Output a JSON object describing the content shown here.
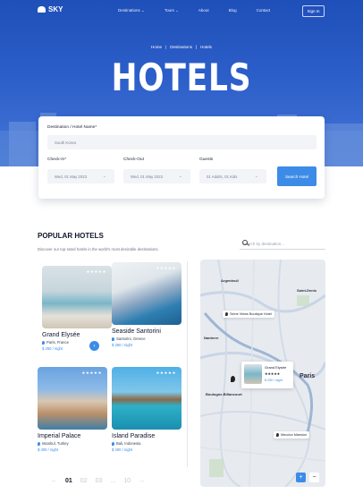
{
  "nav": {
    "logo": "SKY",
    "menu": [
      "Destinations",
      "Tours",
      "About",
      "Blog",
      "Contact"
    ],
    "signin": "Sign In"
  },
  "hero": {
    "breadcrumb": [
      "Home",
      "Destinations",
      "Hotels"
    ],
    "title": "HOTELS"
  },
  "search_form": {
    "destination_label": "Destination / Hotel Name*",
    "destination_value": "South Korea",
    "checkin_label": "Check-In*",
    "checkin_value": "Wed, 01 May 2023",
    "checkout_label": "Check-Out",
    "checkout_value": "Wed, 01 May 2023",
    "guests_label": "Guests",
    "guests_value": "01 Adults, 01 Kids",
    "button": "Search Hotel"
  },
  "popular": {
    "title": "POPULAR HOTELS",
    "subtitle": "Discover our top-rated hotels in the world's most desirable destinations.",
    "search_placeholder": "Search by destination..."
  },
  "hotels": [
    {
      "name": "Grand Elysée",
      "location": "Paris, France",
      "price": "$ 250 / night",
      "stars": "★★★★★"
    },
    {
      "name": "Seaside Santorini",
      "location": "Santorini, Greece",
      "price": "$ 350 / night",
      "stars": "★★★★★"
    },
    {
      "name": "Imperial Palace",
      "location": "Istanbul, Turkey",
      "price": "$ 400 / night",
      "stars": "★★★★★"
    },
    {
      "name": "Island Paradise",
      "location": "Bali, Indonesia",
      "price": "$ 400 / night",
      "stars": "★★★★★"
    }
  ],
  "pagination": [
    "01",
    "02",
    "03",
    "...",
    "10"
  ],
  "map": {
    "labels": [
      "Argenteuil",
      "Saint-Denis",
      "Nanterre",
      "Paris",
      "Boulogne-Billancourt"
    ],
    "tag_top": "Seine Views Boutique Hotel",
    "tag_bottom": "Meudon Mansion",
    "popup_name": "Grand Elysée",
    "popup_stars": "★★★★★",
    "popup_price": "$ 250 / night",
    "zoom_in": "+",
    "zoom_out": "−"
  },
  "colors": {
    "accent": "#3c8ce7",
    "hero": "#2c5ec9"
  }
}
